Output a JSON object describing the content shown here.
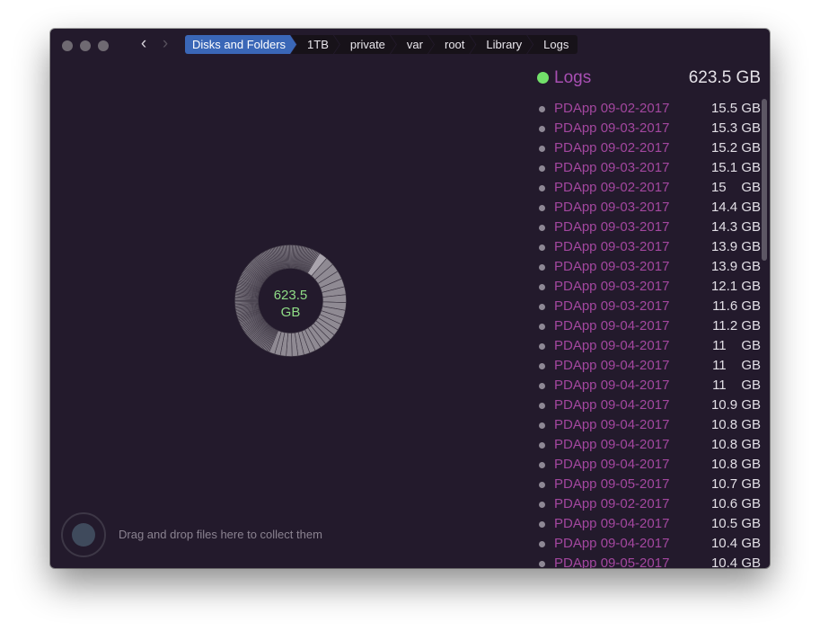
{
  "titlebar": {
    "back_icon": "chevron-left-icon",
    "forward_icon": "chevron-right-icon",
    "breadcrumbs": [
      "Disks and Folders",
      "1TB",
      "private",
      "var",
      "root",
      "Library",
      "Logs"
    ]
  },
  "chart": {
    "center_value": "623.5",
    "center_unit": "GB"
  },
  "chart_data": {
    "type": "pie",
    "total": "623.5 GB",
    "segments_gb": [
      15.5,
      15.3,
      15.2,
      15.1,
      15,
      14.4,
      14.3,
      13.9,
      13.9,
      12.1,
      11.6,
      11.2,
      11,
      11,
      11,
      10.9,
      10.8,
      10.8,
      10.8,
      10.7,
      10.6,
      10.5,
      10.4,
      10.4
    ],
    "segment_color": "#8f8a93",
    "highlight_color": "#a9a4ad"
  },
  "collector": {
    "hint": "Drag and drop files here to collect them"
  },
  "panel": {
    "title": "Logs",
    "size": "623.5 GB",
    "title_color": "#a84fb3",
    "dot_color": "#72e06a",
    "items": [
      {
        "name": "PDApp 09-02-2017",
        "size": "15.5 GB"
      },
      {
        "name": "PDApp 09-03-2017",
        "size": "15.3 GB"
      },
      {
        "name": "PDApp 09-02-2017",
        "size": "15.2 GB"
      },
      {
        "name": "PDApp 09-03-2017",
        "size": "15.1 GB"
      },
      {
        "name": "PDApp 09-02-2017",
        "size": "15    GB"
      },
      {
        "name": "PDApp 09-03-2017",
        "size": "14.4 GB"
      },
      {
        "name": "PDApp 09-03-2017",
        "size": "14.3 GB"
      },
      {
        "name": "PDApp 09-03-2017",
        "size": "13.9 GB"
      },
      {
        "name": "PDApp 09-03-2017",
        "size": "13.9 GB"
      },
      {
        "name": "PDApp 09-03-2017",
        "size": "12.1 GB"
      },
      {
        "name": "PDApp 09-03-2017",
        "size": "11.6 GB"
      },
      {
        "name": "PDApp 09-04-2017",
        "size": "11.2 GB"
      },
      {
        "name": "PDApp 09-04-2017",
        "size": "11    GB"
      },
      {
        "name": "PDApp 09-04-2017",
        "size": "11    GB"
      },
      {
        "name": "PDApp 09-04-2017",
        "size": "11    GB"
      },
      {
        "name": "PDApp 09-04-2017",
        "size": "10.9 GB"
      },
      {
        "name": "PDApp 09-04-2017",
        "size": "10.8 GB"
      },
      {
        "name": "PDApp 09-04-2017",
        "size": "10.8 GB"
      },
      {
        "name": "PDApp 09-04-2017",
        "size": "10.8 GB"
      },
      {
        "name": "PDApp 09-05-2017",
        "size": "10.7 GB"
      },
      {
        "name": "PDApp 09-02-2017",
        "size": "10.6 GB"
      },
      {
        "name": "PDApp 09-04-2017",
        "size": "10.5 GB"
      },
      {
        "name": "PDApp 09-04-2017",
        "size": "10.4 GB"
      },
      {
        "name": "PDApp 09-05-2017",
        "size": "10.4 GB"
      }
    ]
  }
}
